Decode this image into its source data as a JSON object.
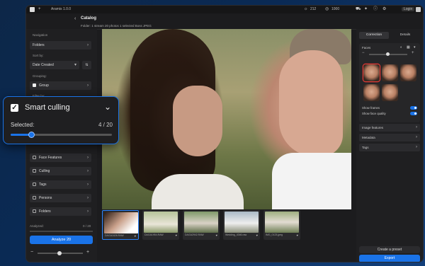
{
  "app": {
    "name": "Aramis 1.0.0"
  },
  "titlebar": {
    "stat1": "212",
    "stat2": "1000",
    "login": "Login"
  },
  "header": {
    "title": "Catalog",
    "subtitle": "Folder: 1 stream   20 photos   1 selected   Boss JPEG"
  },
  "sidebar": {
    "navigation_label": "Navigation",
    "folders_label": "Folders",
    "sort_label": "Sort by:",
    "sort_value": "Date Created",
    "grouping_label": "Grouping:",
    "group_label": "Group",
    "filter_label": "Filter by:",
    "filters": [
      "Face Features",
      "Culling",
      "Tags",
      "Persons",
      "Folders"
    ],
    "analyzed_label": "Analyzed:",
    "analyzed_value": "0 / 20",
    "analyze_button": "Analyze 20"
  },
  "popup": {
    "title": "Smart culling",
    "selected_label": "Selected:",
    "selected_count": "4 / 20",
    "selected_fraction": 0.2
  },
  "filmstrip": [
    {
      "caption": "DAGA1626.RAW"
    },
    {
      "caption": "DAGA1954.RAW"
    },
    {
      "caption": "DAGA2942.RAW"
    },
    {
      "caption": "Wedding_4346.raw"
    },
    {
      "caption": "IMG_0123.jpeg"
    }
  ],
  "right_panel": {
    "tab_correction": "Correction",
    "tab_details": "Details",
    "faces_label": "Faces",
    "show_frames": "Show frames",
    "show_face_quality": "Show face quality",
    "rows": [
      "Image features",
      "Metadata",
      "Tags"
    ],
    "create_preset": "Create a preset",
    "export": "Export"
  },
  "colors": {
    "accent": "#1a73e8",
    "panel": "#1f1f21",
    "background": "#0b1f3a"
  }
}
